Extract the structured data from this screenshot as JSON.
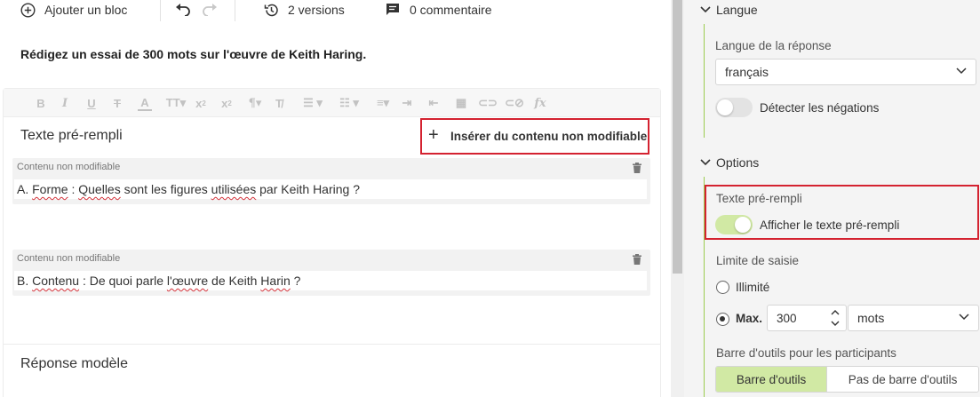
{
  "topbar": {
    "add_block": "Ajouter un bloc",
    "versions": "2 versions",
    "comments": "0 commentaire"
  },
  "question": "Rédigez un essai de 300 mots sur l'œuvre de Keith Haring.",
  "editor": {
    "toolbar_icons": [
      "bold-icon",
      "italic-icon",
      "underline-icon",
      "strikethrough-icon",
      "text-color-icon",
      "font-size-icon",
      "subscript-icon",
      "superscript-icon",
      "paragraph-icon",
      "clear-format-icon",
      "bullet-list-icon",
      "numbered-list-icon",
      "align-icon",
      "indent-icon",
      "outdent-icon",
      "table-icon",
      "link-icon",
      "unlink-icon",
      "formula-icon"
    ],
    "prefill_title": "Texte pré-rempli",
    "insert_button": "Insérer du contenu non modifiable",
    "blocks": [
      {
        "label": "Contenu non modifiable",
        "text_parts": [
          "A. ",
          "Forme",
          " : ",
          "Quelles",
          " sont les figures ",
          "utilisées",
          " par Keith Haring ?"
        ]
      },
      {
        "label": "Contenu non modifiable",
        "text_parts": [
          "B. ",
          "Contenu",
          " : De quoi parle ",
          "l'œuvre",
          " de Keith ",
          "Harin",
          " ?"
        ]
      }
    ],
    "model_answer_title": "Réponse modèle"
  },
  "settings": {
    "language_section": "Langue",
    "response_language_label": "Langue de la réponse",
    "response_language_value": "français",
    "detect_negations": "Détecter les négations",
    "options_section": "Options",
    "prefill_label": "Texte pré-rempli",
    "prefill_toggle": "Afficher le texte pré-rempli",
    "input_limit_label": "Limite de saisie",
    "unlimited": "Illimité",
    "max": "Max.",
    "max_value": "300",
    "unit": "mots",
    "toolbar_label": "Barre d'outils pour les participants",
    "toolbar_on": "Barre d'outils",
    "toolbar_off": "Pas de barre d'outils"
  },
  "colors": {
    "accent_green": "#9bcd4f",
    "toggle_on": "#d1e9a4",
    "highlight_red": "#d42230"
  }
}
